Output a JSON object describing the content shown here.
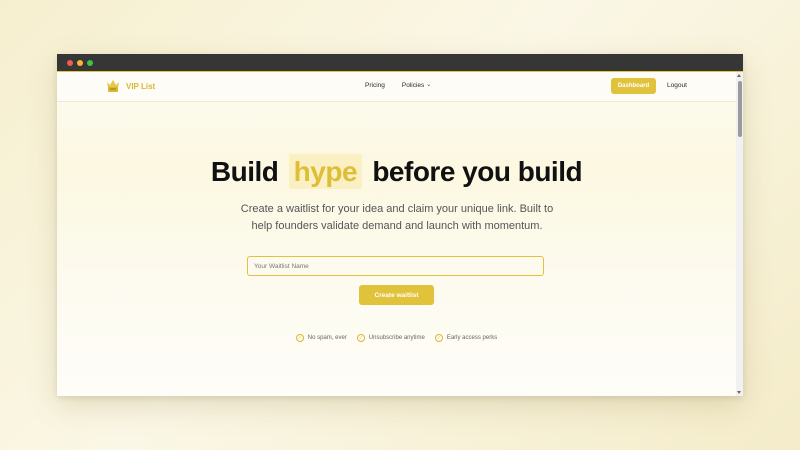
{
  "brand": {
    "name": "VIP List",
    "color": "#d9b82f"
  },
  "nav": {
    "links": [
      {
        "label": "Pricing"
      },
      {
        "label": "Policies",
        "icon": "chevron-down-icon"
      }
    ],
    "dashboard_label": "Dashboard",
    "logout_label": "Logout"
  },
  "hero": {
    "title_before": "Build",
    "title_highlight": "hype",
    "title_after": "before you build",
    "subtitle": "Create a waitlist for your idea and claim your unique link. Built to help founders validate demand and launch with momentum."
  },
  "form": {
    "input_placeholder": "Your Waitlist Name",
    "input_value": "",
    "submit_label": "Create waitlist"
  },
  "features": [
    {
      "label": "No spam, ever",
      "icon": "check-circle-icon"
    },
    {
      "label": "Unsubscribe anytime",
      "icon": "check-circle-icon"
    },
    {
      "label": "Early access perks",
      "icon": "check-circle-icon"
    }
  ],
  "colors": {
    "accent": "#e1c23b",
    "highlight_bg": "#faf0c4",
    "titlebar": "#363636"
  }
}
